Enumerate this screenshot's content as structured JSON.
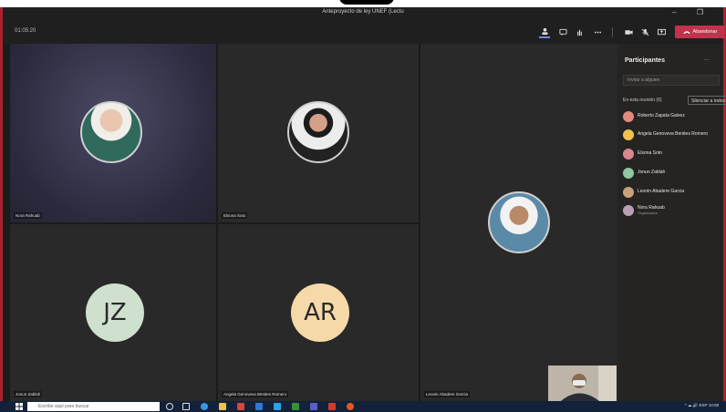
{
  "window": {
    "title": "Anteproyecto de ley UNEF (Lectu",
    "controls": "–  ❐"
  },
  "header": {
    "timer": "01:05:20",
    "hangup_label": "Abandonar"
  },
  "tiles": [
    {
      "name": "Nora Rahuab",
      "kind": "photo"
    },
    {
      "name": "Elsona Soto",
      "kind": "photo"
    },
    {
      "name": "Leonin Abadere Garcia",
      "kind": "photo"
    },
    {
      "name": "Jonun Zablah",
      "kind": "initials",
      "initials": "JZ",
      "color": "#cfe0cf"
    },
    {
      "name": "Angela Genoveva Benites Romero",
      "kind": "initials",
      "initials": "AR",
      "color": "#f5d9a8"
    }
  ],
  "participants": {
    "title": "Participantes",
    "more": "...",
    "search_placeholder": "Invitar a alguien",
    "section_label": "En esta reunión (6)",
    "mute_all": "Silenciar a todos",
    "list": [
      {
        "name": "Roberto Zapata Galvez",
        "subtitle": "",
        "color": "#e28a7c"
      },
      {
        "name": "Angela Genoveva Benites Romero",
        "subtitle": "",
        "color": "#f2c14e"
      },
      {
        "name": "Elsona Soto",
        "subtitle": "",
        "color": "#d9868f"
      },
      {
        "name": "Jonun Zablah",
        "subtitle": "",
        "color": "#8fc5a0"
      },
      {
        "name": "Leonin Abadere Garcia",
        "subtitle": "",
        "color": "#c8a07a"
      },
      {
        "name": "Nora Rahuab",
        "subtitle": "Organizador",
        "color": "#b9a0b6"
      }
    ]
  },
  "taskbar": {
    "search_placeholder": "Escribe aquí para buscar",
    "tray": "^ ☁ 🔊 ESP  10:08"
  }
}
